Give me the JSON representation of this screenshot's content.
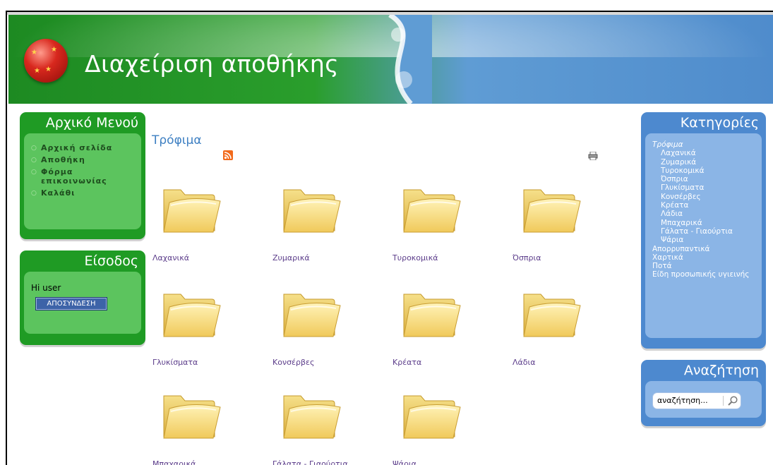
{
  "header": {
    "title": "Διαχείριση αποθήκης",
    "logo": "globe-logo-icon"
  },
  "main_menu": {
    "title": "Αρχικό Μενού",
    "items": [
      {
        "label": "Αρχική σελίδα"
      },
      {
        "label": "Αποθήκη"
      },
      {
        "label": "Φόρμα επικοινωνίας"
      },
      {
        "label": "Καλάθι"
      }
    ]
  },
  "login": {
    "title": "Είσοδος",
    "greeting": "Hi user",
    "logout_label": "ΑΠΟΣΥΝΔΕΣΗ"
  },
  "content": {
    "title": "Τρόφιμα",
    "rss_icon": "rss-icon",
    "print_icon": "printer-icon",
    "folders": [
      {
        "label": "Λαχανικά"
      },
      {
        "label": "Ζυμαρικά"
      },
      {
        "label": "Τυροκομικά"
      },
      {
        "label": "Όσπρια"
      },
      {
        "label": "Γλυκίσματα"
      },
      {
        "label": "Κονσέρβες"
      },
      {
        "label": "Κρέατα"
      },
      {
        "label": "Λάδια"
      },
      {
        "label": "Μπαχαρικά"
      },
      {
        "label": "Γάλατα - Γιαούρτια"
      },
      {
        "label": "Ψάρια"
      }
    ]
  },
  "categories": {
    "title": "Κατηγορίες",
    "items": [
      {
        "label": "Τρόφιμα"
      },
      {
        "label": "Λαχανικά"
      },
      {
        "label": "Ζυμαρικά"
      },
      {
        "label": "Τυροκομικά"
      },
      {
        "label": "Όσπρια"
      },
      {
        "label": "Γλυκίσματα"
      },
      {
        "label": "Κονσέρβες"
      },
      {
        "label": "Κρέατα"
      },
      {
        "label": "Λάδια"
      },
      {
        "label": "Μπαχαρικά"
      },
      {
        "label": "Γάλατα - Γιαούρτια"
      },
      {
        "label": "Ψάρια"
      },
      {
        "label": "Απορρυπαντικά"
      },
      {
        "label": "Χαρτικά"
      },
      {
        "label": "Ποτά"
      },
      {
        "label": "Είδη προσωπικής υγιεινής"
      }
    ]
  },
  "search": {
    "title": "Αναζήτηση",
    "value": "αναζήτηση...",
    "button_icon": "magnifier-icon"
  },
  "colors": {
    "header_green": "#1d8a22",
    "header_blue": "#4f8ccc",
    "menu_green": "#1f9b24",
    "menu_green_light": "#5cc45e",
    "sidebar_blue": "#4d89cf",
    "sidebar_blue_light": "#8bb5e6",
    "link_purple": "#5b3c8a",
    "content_title": "#3d7fc2"
  }
}
